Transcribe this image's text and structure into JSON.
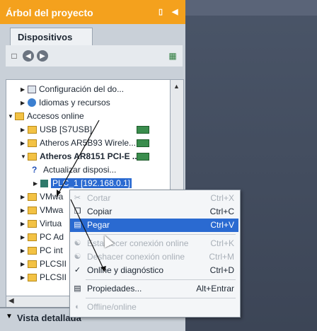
{
  "title": "Árbol del proyecto",
  "tabs": [
    "Dispositivos"
  ],
  "tree": {
    "items": [
      {
        "label": "Configuración del do..."
      },
      {
        "label": "Idiomas y recursos"
      },
      {
        "label": "Accesos online"
      },
      {
        "label": "USB [S7USB]"
      },
      {
        "label": "Atheros AR5B93 Wirele..."
      },
      {
        "label": "Atheros AR8151 PCI-E ..."
      },
      {
        "label": "Actualizar disposi..."
      },
      {
        "label": "PLC_1 [192.168.0.1]"
      },
      {
        "label": "VMwa"
      },
      {
        "label": "VMwa"
      },
      {
        "label": "Virtua"
      },
      {
        "label": "PC Ad"
      },
      {
        "label": "PC int"
      },
      {
        "label": "PLCSII"
      },
      {
        "label": "PLCSII"
      }
    ]
  },
  "details": {
    "label": "Vista detallada"
  },
  "context_menu": {
    "items": [
      {
        "label": "Cortar",
        "shortcut": "Ctrl+X"
      },
      {
        "label": "Copiar",
        "shortcut": "Ctrl+C"
      },
      {
        "label": "Pegar",
        "shortcut": "Ctrl+V"
      },
      {
        "label": "Establecer conexión online",
        "shortcut": "Ctrl+K"
      },
      {
        "label": "Deshacer conexión online",
        "shortcut": "Ctrl+M"
      },
      {
        "label": "Online y diagnóstico",
        "shortcut": "Ctrl+D"
      },
      {
        "label": "Propiedades...",
        "shortcut": "Alt+Entrar"
      },
      {
        "label": "Offline/online",
        "shortcut": ""
      }
    ]
  },
  "colors": {
    "title_bar": "#f4a11d",
    "selection": "#2a6ad1",
    "highlight": "#fff500"
  }
}
